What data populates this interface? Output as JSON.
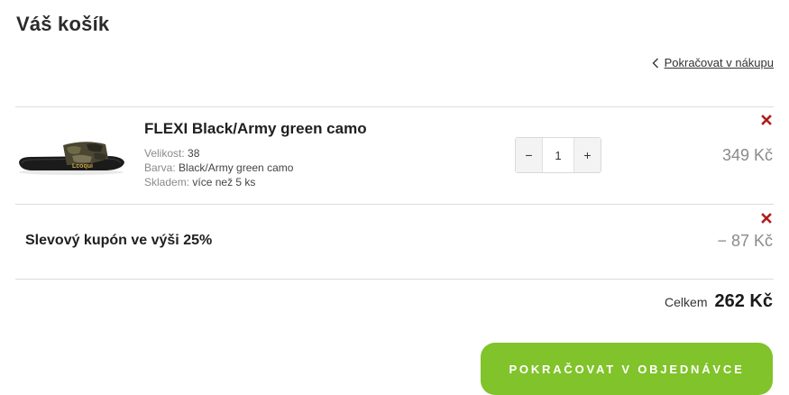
{
  "page": {
    "title": "Váš košík"
  },
  "nav": {
    "continue_shopping": "Pokračovat v nákupu"
  },
  "cart": {
    "item": {
      "name": "FLEXI Black/Army green camo",
      "size_label": "Velikost:",
      "size_value": "38",
      "color_label": "Barva:",
      "color_value": "Black/Army green camo",
      "stock_label": "Skladem:",
      "stock_value": "více než 5 ks",
      "quantity": "1",
      "price": "349 Kč",
      "decrement_label": "−",
      "increment_label": "+"
    },
    "coupon": {
      "label": "Slevový kupón ve výši 25%",
      "amount": "− 87 Kč"
    },
    "total": {
      "label": "Celkem",
      "value": "262 Kč"
    }
  },
  "checkout": {
    "button_label": "POKRAČOVAT V OBJEDNÁVCE"
  },
  "icons": {
    "back": "chevron-left-icon",
    "remove": "close-icon"
  },
  "colors": {
    "accent": "#80c32a",
    "remove": "#b01c1c",
    "muted_text": "#8a8a8a",
    "divider": "#dcdcdc"
  }
}
